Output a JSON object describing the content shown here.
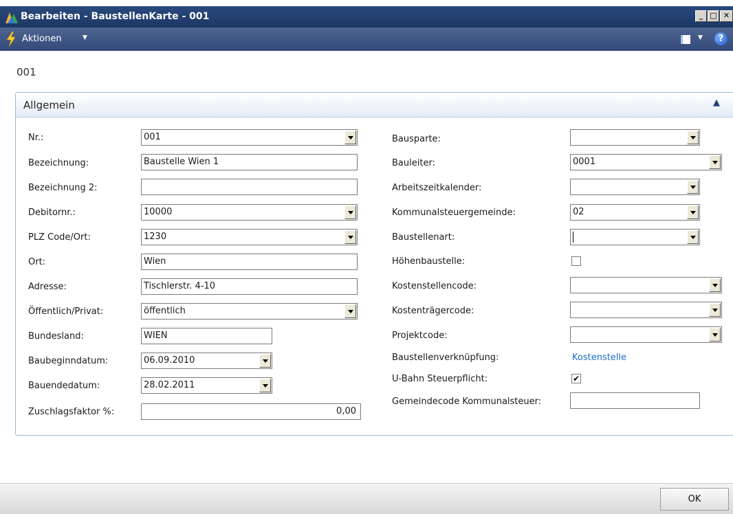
{
  "window": {
    "title": "Bearbeiten - BaustellenKarte - 001",
    "controls": {
      "minimize": "_",
      "maximize": "□",
      "close": "✕"
    }
  },
  "actionbar": {
    "actions_label": "Aktionen",
    "help_label": "?"
  },
  "record_number": "001",
  "fasttab": {
    "title": "Allgemein"
  },
  "left_fields": {
    "nr": {
      "label": "Nr.:",
      "value": "001"
    },
    "bezeichnung": {
      "label": "Bezeichnung:",
      "value": "Baustelle Wien 1"
    },
    "bezeichnung2": {
      "label": "Bezeichnung 2:",
      "value": ""
    },
    "debitornr": {
      "label": "Debitornr.:",
      "value": "10000"
    },
    "plz": {
      "label": "PLZ Code/Ort:",
      "value": "1230"
    },
    "ort": {
      "label": "Ort:",
      "value": "Wien"
    },
    "adresse": {
      "label": "Adresse:",
      "value": "Tischlerstr. 4-10"
    },
    "oeffentlich": {
      "label": "Öffentlich/Privat:",
      "value": "öffentlich"
    },
    "bundesland": {
      "label": "Bundesland:",
      "value": "WIEN"
    },
    "baubeginn": {
      "label": "Baubegin ndatum:",
      "value": "06.09.2010"
    },
    "bauende": {
      "label": "Bauendedatum:",
      "value": "28.02.2011"
    },
    "zuschlag": {
      "label": "Zuschlagsfaktor %:",
      "value": "0,00"
    }
  },
  "right_fields": {
    "bausparte": {
      "label": "Bausparte:",
      "value": ""
    },
    "bauleiter": {
      "label": "Bauleiter:",
      "value": "0001"
    },
    "arbeitszeit": {
      "label": "Arbeitszeitkalender:",
      "value": ""
    },
    "kommunal": {
      "label": "Kommunalsteuergemeinde:",
      "value": "02"
    },
    "baustellenart": {
      "label": "Baustellenart:",
      "value": ""
    },
    "hoehen": {
      "label": "Höhenbaustelle:",
      "checked": false
    },
    "kostenstelle": {
      "label": "Kostenstellencode:",
      "value": ""
    },
    "kostentraeger": {
      "label": "Kostenträgercode:",
      "value": ""
    },
    "projekt": {
      "label": "Projektcode:",
      "value": ""
    },
    "verknuepfung": {
      "label": "Baustellenverknüpfung:",
      "value": "Kostenstelle"
    },
    "ubahn": {
      "label": "U-Bahn Steuerpflicht:",
      "checked": true,
      "mark": "✔"
    },
    "gemeindecode": {
      "label": "Gemeindecode Kommunalsteuer:",
      "value": ""
    }
  },
  "footer": {
    "ok_label": "OK"
  },
  "colors": {
    "titlebar": "#1c3764",
    "actionbar": "#33497a",
    "link": "#1a6dc8",
    "fasttab_border": "#9ab8d8"
  }
}
